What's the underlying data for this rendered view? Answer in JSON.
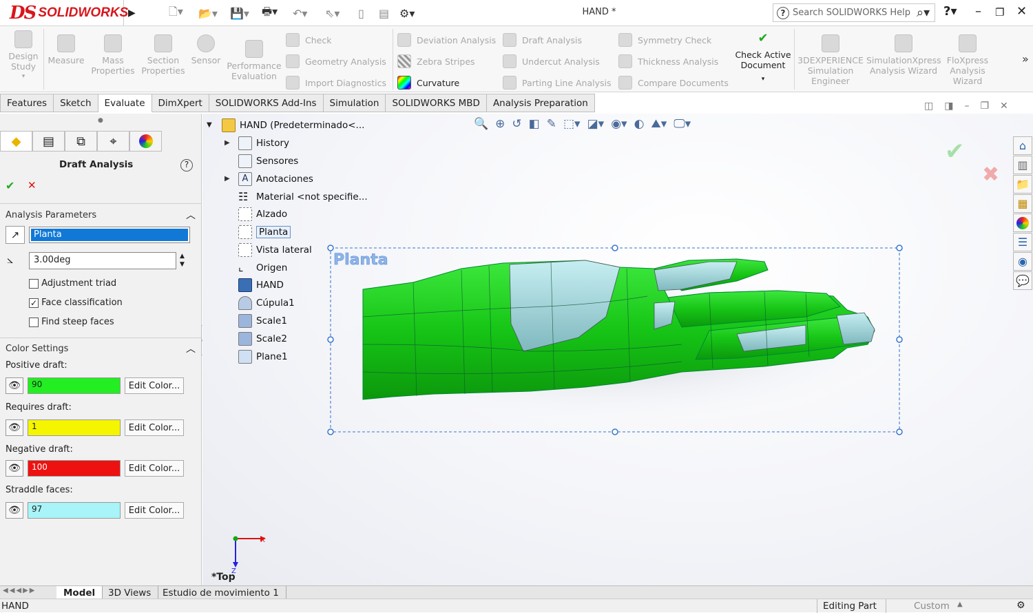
{
  "app": {
    "logo_ds": "DS",
    "logo_text": "SOLIDWORKS",
    "doc_title": "HAND *",
    "search_placeholder": "Search SOLIDWORKS Help"
  },
  "commands": {
    "design_study": "Design Study",
    "measure": "Measure",
    "mass_properties": "Mass Properties",
    "section_properties": "Section Properties",
    "sensor": "Sensor",
    "performance_evaluation": "Performance Evaluation",
    "check": "Check",
    "geometry_analysis": "Geometry Analysis",
    "import_diagnostics": "Import Diagnostics",
    "deviation_analysis": "Deviation Analysis",
    "zebra_stripes": "Zebra Stripes",
    "curvature": "Curvature",
    "draft_analysis": "Draft Analysis",
    "undercut_analysis": "Undercut Analysis",
    "parting_line_analysis": "Parting Line Analysis",
    "symmetry_check": "Symmetry Check",
    "thickness_analysis": "Thickness Analysis",
    "compare_documents": "Compare Documents",
    "check_active_document": "Check Active Document",
    "threedx_simulation": "3DEXPERIENCE Simulation Engineer",
    "simxpress": "SimulationXpress Analysis Wizard",
    "floxpress": "FloXpress Analysis Wizard"
  },
  "tabs": [
    "Features",
    "Sketch",
    "Evaluate",
    "DimXpert",
    "SOLIDWORKS Add-Ins",
    "Simulation",
    "SOLIDWORKS MBD",
    "Analysis Preparation"
  ],
  "panel": {
    "title": "Draft Analysis",
    "analysis_parameters": "Analysis Parameters",
    "direction_value": "Planta",
    "angle_value": "3.00deg",
    "adjustment_triad": "Adjustment triad",
    "face_classification": "Face classification",
    "find_steep_faces": "Find steep faces",
    "color_settings": "Color Settings",
    "positive_label": "Positive draft:",
    "positive_count": "90",
    "positive_color": "#22ee22",
    "requires_label": "Requires draft:",
    "requires_count": "1",
    "requires_color": "#f5f500",
    "negative_label": "Negative draft:",
    "negative_count": "100",
    "negative_color": "#ee1111",
    "straddle_label": "Straddle faces:",
    "straddle_count": "97",
    "straddle_color": "#a8f4f8",
    "edit_color": "Edit Color..."
  },
  "tree": {
    "root": "HAND  (Predeterminado<...",
    "items": [
      "History",
      "Sensores",
      "Anotaciones",
      "Material <not specifie...",
      "Alzado",
      "Planta",
      "Vista lateral",
      "Origen",
      "HAND",
      "Cúpula1",
      "Scale1",
      "Scale2",
      "Plane1"
    ]
  },
  "viewport": {
    "plane_label": "Planta",
    "view_label": "*Top",
    "axis_x": "X",
    "axis_z": "Z"
  },
  "bottom_tabs": [
    "Model",
    "3D Views",
    "Estudio de movimiento 1"
  ],
  "status": {
    "left": "HAND",
    "editing": "Editing Part",
    "units": "Custom"
  }
}
